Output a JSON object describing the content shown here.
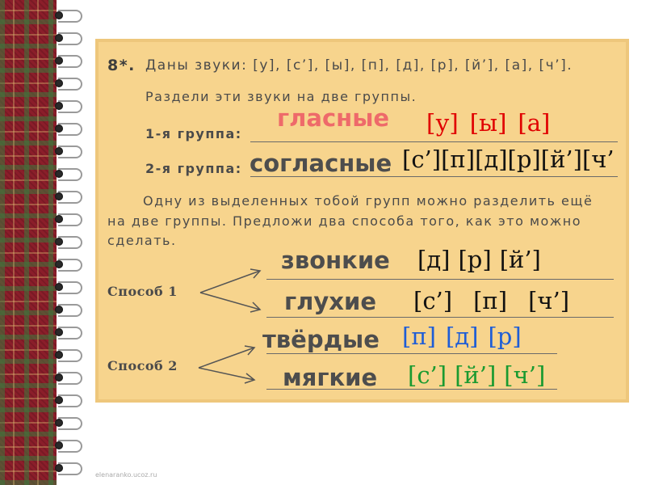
{
  "task": {
    "number": "8*.",
    "sounds_intro": "Даны звуки: [у], [с’], [ы], [п], [д], [р], [й’], [а], [ч’].",
    "instruction": "Раздели эти звуки на две группы.",
    "group1_label": "1-я группа:",
    "group2_label": "2-я группа:",
    "para_line1": "Одну из выделенных тобой групп можно разделить ещё",
    "para_line2": "на две группы. Предложи два способа того, как это можно",
    "para_line3": "сделать.",
    "method1_label": "Способ 1",
    "method2_label": "Способ 2"
  },
  "answers": {
    "vowels_title": "гласные",
    "vowels": [
      "[у]",
      "[ы]",
      "[а]"
    ],
    "consonants_title": "согласные",
    "consonants": [
      "[с’]",
      "[п]",
      "[д]",
      "[р]",
      "[й’]",
      "[ч’"
    ],
    "voiced_title": "звонкие",
    "voiced": [
      "[д]",
      "[р]",
      "[й’]"
    ],
    "voiceless_title": "глухие",
    "voiceless": [
      "[с’]",
      "[п]",
      "[ч’]"
    ],
    "hard_title": "твёрдые",
    "hard": [
      "[п]",
      "[д]",
      "[р]"
    ],
    "soft_title": "мягкие",
    "soft": [
      "[с’]",
      "[й’]",
      "[ч’]"
    ]
  },
  "footer": "elenaranko.ucoz.ru",
  "colors": {
    "panel": "#f7d48d",
    "vowel_title_red": "#ee6a6a",
    "vowel_sound_red": "#e00000",
    "hard_blue": "#1e5dd6",
    "soft_green": "#1a9a30",
    "plaid_red": "#8b1e2a"
  }
}
